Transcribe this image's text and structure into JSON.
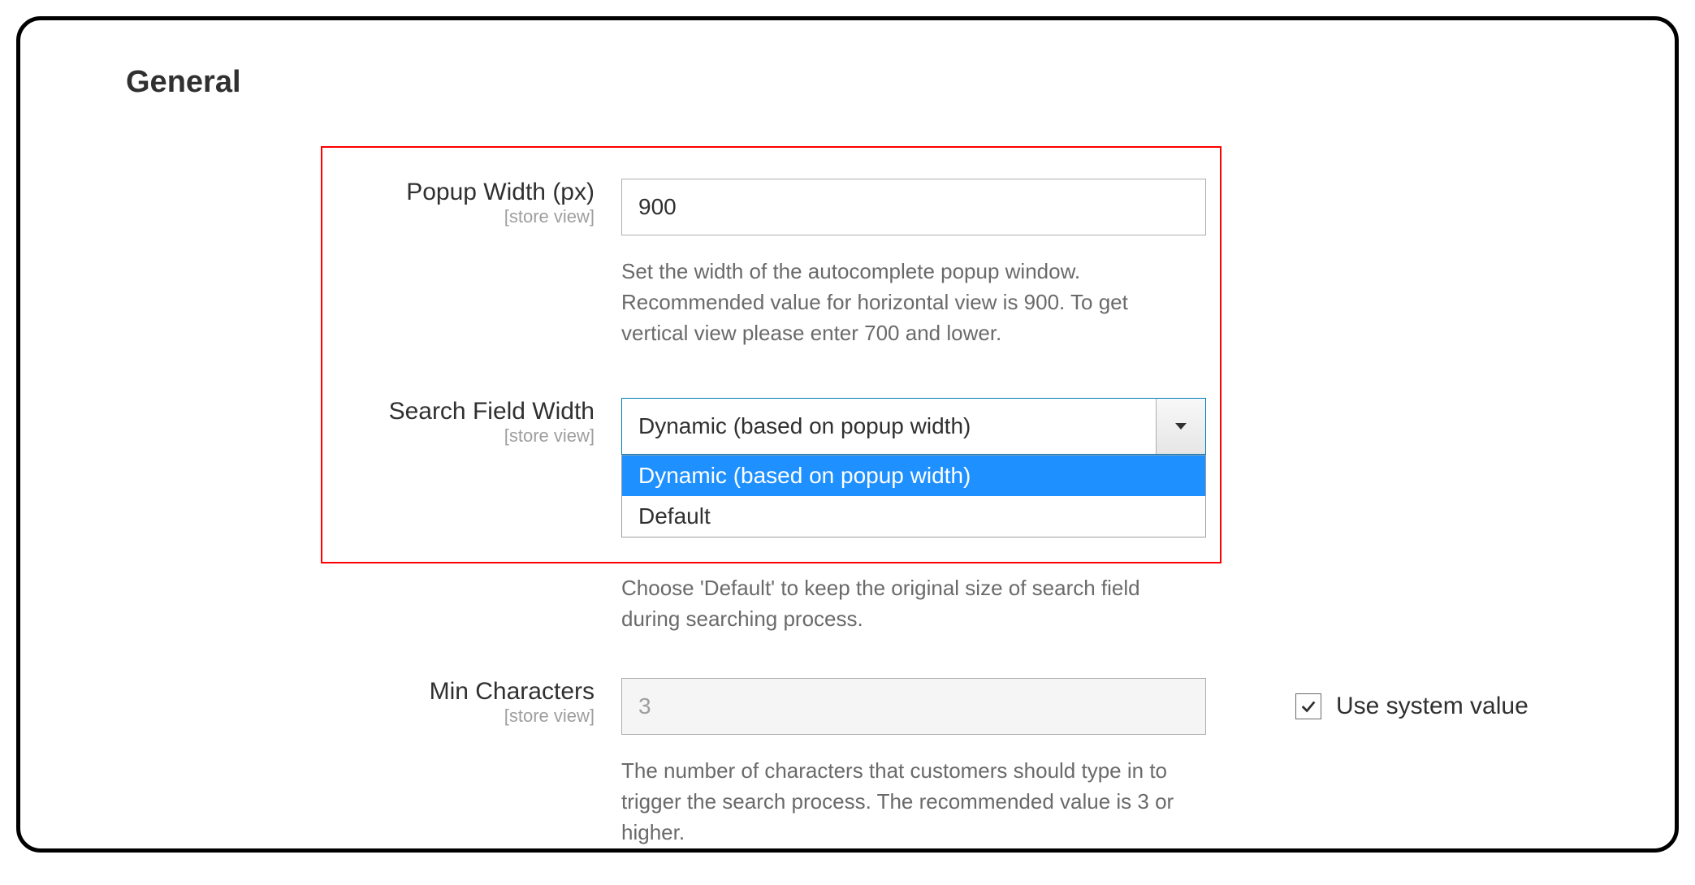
{
  "section": {
    "title": "General"
  },
  "fields": {
    "popup_width": {
      "label": "Popup Width (px)",
      "scope": "[store view]",
      "value": "900",
      "help": "Set the width of the autocomplete popup window. Recommended value for horizontal view is 900. To get vertical view please enter 700 and lower."
    },
    "search_field_width": {
      "label": "Search Field Width",
      "scope": "[store view]",
      "selected": "Dynamic (based on popup width)",
      "options": [
        "Dynamic (based on popup width)",
        "Default"
      ],
      "help": "Choose 'Default' to keep the original size of search field during searching process."
    },
    "min_characters": {
      "label": "Min Characters",
      "scope": "[store view]",
      "value": "3",
      "help": "The number of characters that customers should type in to trigger the search process. The recommended value is 3 or higher.",
      "use_system_label": "Use system value",
      "use_system_checked": true
    }
  }
}
